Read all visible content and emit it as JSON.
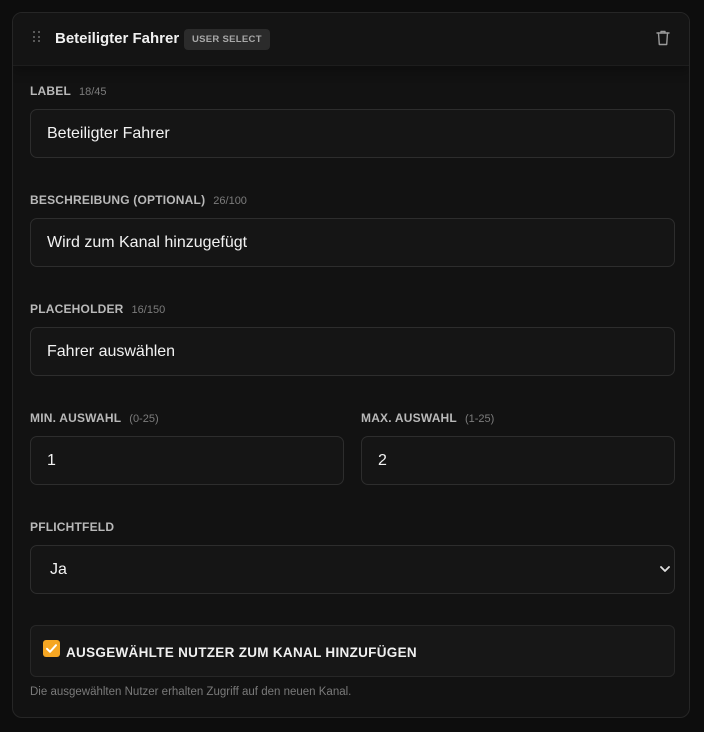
{
  "header": {
    "title": "Beteiligter Fahrer",
    "badge": "USER SELECT"
  },
  "fields": {
    "label": {
      "caption": "LABEL",
      "counter": "18/45",
      "value": "Beteiligter Fahrer"
    },
    "description": {
      "caption": "BESCHREIBUNG (OPTIONAL)",
      "counter": "26/100",
      "value": "Wird zum Kanal hinzugefügt"
    },
    "placeholder": {
      "caption": "PLACEHOLDER",
      "counter": "16/150",
      "value": "Fahrer auswählen"
    },
    "min_select": {
      "caption": "MIN. AUSWAHL",
      "range": "(0-25)",
      "value": "1"
    },
    "max_select": {
      "caption": "MAX. AUSWAHL",
      "range": "(1-25)",
      "value": "2"
    },
    "required": {
      "caption": "PFLICHTFELD",
      "selected": "Ja"
    }
  },
  "add_to_channel": {
    "checked": true,
    "label": "AUSGEWÄHLTE NUTZER ZUM KANAL HINZUFÜGEN",
    "help": "Die ausgewählten Nutzer erhalten Zugriff auf den neuen Kanal."
  },
  "colors": {
    "accent": "#f5a623",
    "background": "#0d0d0d",
    "card": "#121212"
  },
  "icons": {
    "drag": "drag-handle-icon",
    "delete": "trash-icon",
    "dropdown": "chevron-down-icon",
    "check": "checkmark-icon"
  }
}
